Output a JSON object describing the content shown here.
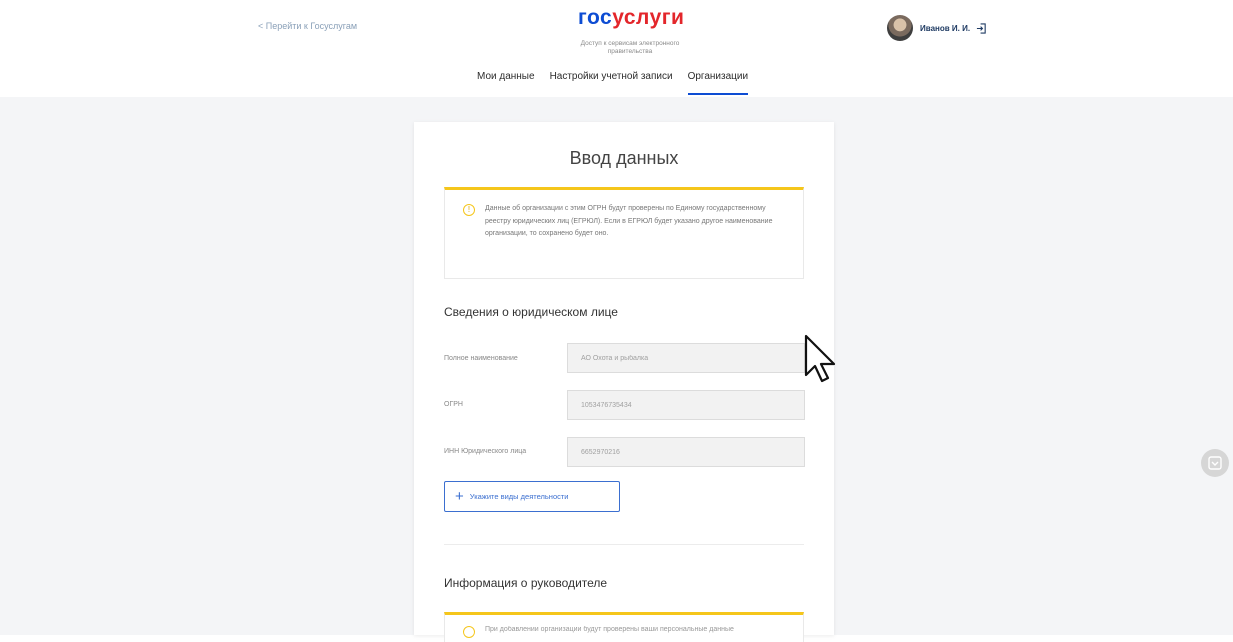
{
  "header": {
    "back_link": "< Перейти к Госуслугам",
    "logo_part1": "гос",
    "logo_part2": "услуги",
    "tagline": "Доступ к сервисам электронного правительства",
    "user_name": "Иванов И. И."
  },
  "tabs": [
    {
      "label": "Мои данные"
    },
    {
      "label": "Настройки учетной записи"
    },
    {
      "label": "Организации"
    }
  ],
  "card": {
    "title": "Ввод данных",
    "notice": "Данные об организации с этим ОГРН будут проверены по Единому государственному реестру юридических лиц (ЕГРЮЛ). Если в ЕГРЮЛ будет указано другое наименование организации, то сохранено будет оно.",
    "section_legal": "Сведения о юридическом лице",
    "fields": [
      {
        "label": "Полное наименование",
        "value": "АО Охота и рыбалка"
      },
      {
        "label": "ОГРН",
        "value": "1053476735434"
      },
      {
        "label": "ИНН Юридического лица",
        "value": "6652970216"
      }
    ],
    "activity_button": "Укажите виды деятельности",
    "section_head": "Информация о руководителе",
    "notice2": "При добавлении организации будут проверены ваши персональные данные"
  },
  "colors": {
    "logo_blue": "#0d4cd3",
    "logo_red": "#e3262b",
    "notice_border": "#f5c61b",
    "accent": "#3b6fd0"
  }
}
